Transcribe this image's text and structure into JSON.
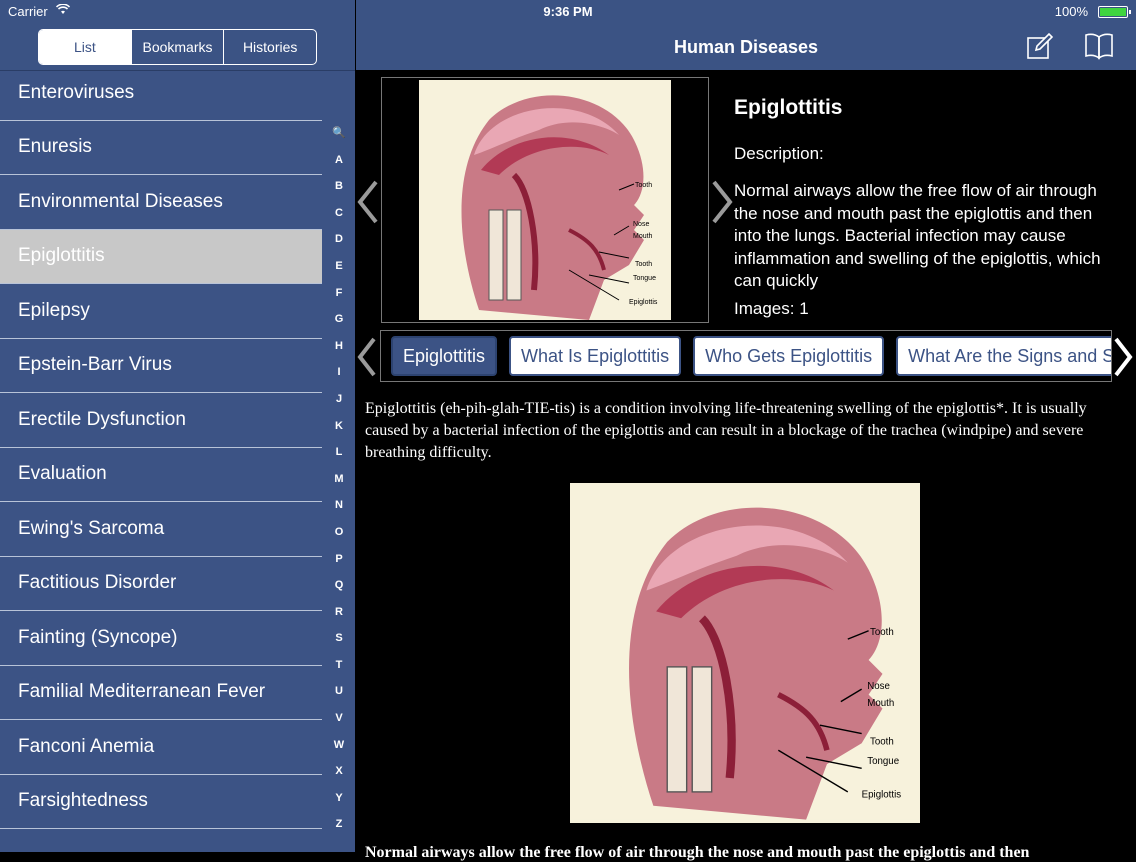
{
  "status_bar": {
    "carrier": "Carrier",
    "time": "9:36 PM",
    "battery": "100%"
  },
  "sidebar": {
    "segments": [
      {
        "label": "List",
        "active": true
      },
      {
        "label": "Bookmarks",
        "active": false
      },
      {
        "label": "Histories",
        "active": false
      }
    ],
    "items": [
      "Enteroviruses",
      "Enuresis",
      "Environmental Diseases",
      "Epiglottitis",
      "Epilepsy",
      "Epstein-Barr Virus",
      "Erectile Dysfunction",
      "Evaluation",
      "Ewing's Sarcoma",
      "Factitious Disorder",
      "Fainting (Syncope)",
      "Familial Mediterranean Fever",
      "Fanconi Anemia",
      "Farsightedness"
    ],
    "selected_index": 3,
    "index_letters": [
      "🔍",
      "A",
      "B",
      "C",
      "D",
      "E",
      "F",
      "G",
      "H",
      "I",
      "J",
      "K",
      "L",
      "M",
      "N",
      "O",
      "P",
      "Q",
      "R",
      "S",
      "T",
      "U",
      "V",
      "W",
      "X",
      "Y",
      "Z"
    ]
  },
  "header": {
    "title": "Human Diseases",
    "compose_icon": "compose-icon",
    "book_icon": "book-icon"
  },
  "detail": {
    "title": "Epiglottitis",
    "description_label": "Description:",
    "description": "Normal airways allow the free flow of air through the nose and mouth past the epiglottis and then into the lungs. Bacterial infection may cause inflammation and swelling of the epiglottis, which can quickly",
    "images_label": "Images:  1"
  },
  "diagram_labels": [
    "Tooth",
    "Nose",
    "Mouth",
    "Tooth",
    "Tongue",
    "Epiglottis"
  ],
  "tabs": [
    {
      "label": "Epiglottitis",
      "active": true
    },
    {
      "label": "What Is Epiglottitis",
      "active": false
    },
    {
      "label": "Who Gets Epiglottitis",
      "active": false
    },
    {
      "label": "What Are the Signs and Symptoms",
      "active": false
    }
  ],
  "article": {
    "intro": "Epiglottitis (eh-pih-glah-TIE-tis) is a condition involving life-threatening swelling of the epiglottis*. It is usually caused by a bacterial infection of the epiglottis and can result in a blockage of the trachea (windpipe) and severe breathing difficulty.",
    "caption": "Normal airways allow the free flow of air through the nose and mouth past the epiglottis and then"
  },
  "colors": {
    "nav_blue": "#3b5384",
    "sidebar_blue": "#3c5385",
    "selected_gray": "#c8c8c8"
  }
}
